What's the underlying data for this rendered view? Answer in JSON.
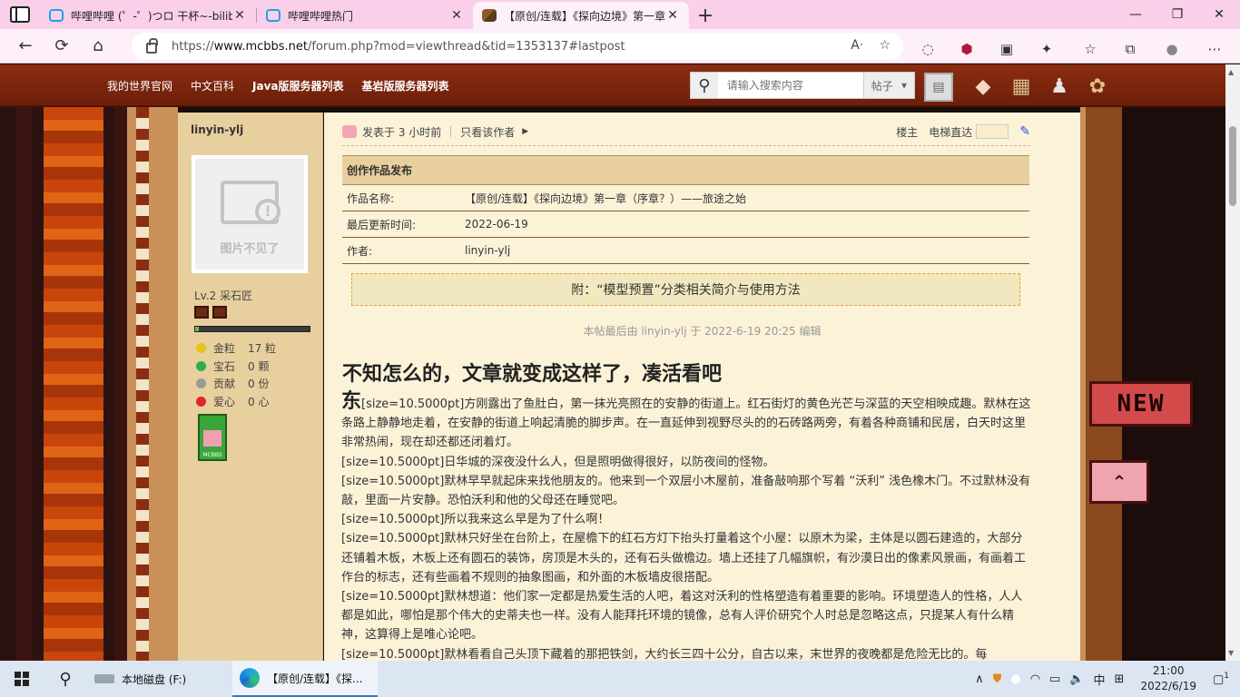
{
  "browser": {
    "tabs": [
      {
        "title": "哔哩哔哩 (゜-゜)つロ 干杯~-bilibili",
        "icon": "bilibili-icon",
        "active": false
      },
      {
        "title": "哔哩哔哩热门",
        "icon": "bilibili-icon",
        "active": false
      },
      {
        "title": "【原创/连载】《探向边境》第一章",
        "icon": "minecraft-block-icon",
        "active": true
      }
    ],
    "url_prefix": "https://",
    "url_domain": "www.mcbbs.net",
    "url_path": "/forum.php?mod=viewthread&tid=1353137#lastpost"
  },
  "site_nav": {
    "links": [
      "我的世界官网",
      "中文百科",
      "Java版服务器列表",
      "基岩版服务器列表"
    ],
    "search_placeholder": "请输入搜索内容",
    "search_scope": "帖子"
  },
  "author": {
    "name": "linyin-ylj",
    "avatar_caption": "图片不见了",
    "level": "Lv.2 采石匠",
    "xp_fraction": 0.03,
    "stats": [
      {
        "label": "金粒",
        "value": "17 粒",
        "color": "#e6c419"
      },
      {
        "label": "宝石",
        "value": "0 颗",
        "color": "#2fae4c"
      },
      {
        "label": "贡献",
        "value": "0 份",
        "color": "#9a9a9a"
      },
      {
        "label": "爱心",
        "value": "0 心",
        "color": "#d92a2a"
      }
    ],
    "medal_text": "MCBBS"
  },
  "post": {
    "posted": "发表于 3 小时前",
    "only_author": "只看该作者",
    "floor": "楼主",
    "jump_label": "电梯直达",
    "info_title": "创作作品发布",
    "info_rows": [
      {
        "key": "作品名称:",
        "value": "【原创/连载】《探向边境》第一章（序章？）——旅途之始"
      },
      {
        "key": "最后更新时间:",
        "value": "2022-06-19"
      },
      {
        "key": "作者:",
        "value": "linyin-ylj"
      }
    ],
    "notice": "附：“模型预置”分类相关简介与使用方法",
    "edited": "本帖最后由 linyin-ylj 于 2022-6-19 20:25 编辑",
    "heading": "不知怎么的，文章就变成这样了，凑活看吧",
    "first_char": "东",
    "paragraphs": [
      "[size=10.5000pt]方刚露出了鱼肚白，第一抹光亮照在的安静的街道上。红石街灯的黄色光芒与深蓝的天空相映成趣。默林在这条路上静静地走着，在安静的街道上响起清脆的脚步声。在一直延伸到视野尽头的的石砖路两旁，有着各种商铺和民居，白天时这里非常热闹，现在却还都还闭着灯。",
      "[size=10.5000pt]日华城的深夜没什么人，但是照明做得很好，以防夜间的怪物。",
      "[size=10.5000pt]默林早早就起床来找他朋友的。他来到一个双层小木屋前，准备敲响那个写着 “沃利” 浅色橡木门。不过默林没有敲，里面一片安静。恐怕沃利和他的父母还在睡觉吧。",
      "[size=10.5000pt]所以我来这么早是为了什么啊！",
      "[size=10.5000pt]默林只好坐在台阶上，在屋檐下的红石方灯下抬头打量着这个小屋：以原木为梁，主体是以圆石建造的，大部分还铺着木板，木板上还有圆石的装饰，房顶是木头的，还有石头做檐边。墙上还挂了几幅旗帜，有沙漠日出的像素风景画，有画着工作台的标志，还有些画着不规则的抽象图画，和外面的木板墙皮很搭配。",
      "[size=10.5000pt]默林想道：他们家一定都是热爱生活的人吧，着这对沃利的性格塑造有着重要的影响。环境塑造人的性格，人人都是如此，哪怕是那个伟大的史蒂夫也一样。没有人能拜托环境的镜像，总有人评价研究个人时总是忽略这点，只提某人有什么精神，这算得上是唯心论吧。",
      "[size=10.5000pt]默林看看自己头顶下藏着的那把铁剑，大约长三四十公分，自古以来，末世界的夜晚都是危险无比的。每"
    ]
  },
  "stickers": {
    "new_label": "NEW"
  },
  "taskbar": {
    "apps": [
      {
        "label": "本地磁盘 (F:)",
        "active": false
      },
      {
        "label": "【原创/连载】《探...",
        "active": true
      }
    ],
    "ime": "中",
    "time": "21:00",
    "date": "2022/6/19",
    "notifications": "1"
  },
  "colors": {
    "accent_pink": "#f9cfe9",
    "site_red": "#8b2d12",
    "parchment": "#fbf2d8"
  }
}
